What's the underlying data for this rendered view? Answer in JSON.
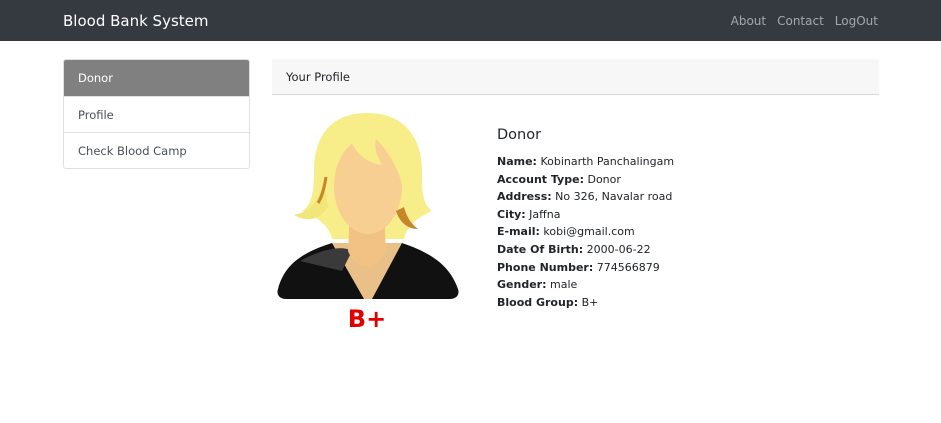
{
  "navbar": {
    "brand": "Blood Bank System",
    "links": [
      "About",
      "Contact",
      "LogOut"
    ]
  },
  "sidebar": {
    "items": [
      {
        "label": "Donor",
        "active": true
      },
      {
        "label": "Profile",
        "active": false
      },
      {
        "label": "Check Blood Camp",
        "active": false
      }
    ]
  },
  "card": {
    "header": "Your Profile"
  },
  "profile": {
    "heading": "Donor",
    "blood_badge": "B+",
    "fields": [
      {
        "label": "Name:",
        "value": "Kobinarth Panchalingam"
      },
      {
        "label": "Account Type:",
        "value": "Donor"
      },
      {
        "label": "Address:",
        "value": "No 326, Navalar road"
      },
      {
        "label": "City:",
        "value": "Jaffna"
      },
      {
        "label": "E-mail:",
        "value": "kobi@gmail.com"
      },
      {
        "label": "Date Of Birth:",
        "value": "2000-06-22"
      },
      {
        "label": "Phone Number:",
        "value": "774566879"
      },
      {
        "label": "Gender:",
        "value": "male"
      },
      {
        "label": "Blood Group:",
        "value": "B+"
      }
    ]
  },
  "colors": {
    "navbar_bg": "#343a40",
    "active_item_bg": "#808080",
    "blood_badge": "#e00000"
  }
}
